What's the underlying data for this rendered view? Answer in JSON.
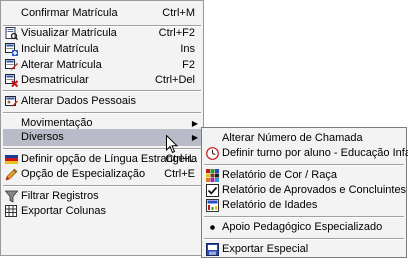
{
  "main_menu": {
    "items": [
      {
        "label": "Confirmar Matrícula",
        "shortcut": "Ctrl+M",
        "icon": "none"
      },
      {
        "label": "Visualizar Matrícula",
        "shortcut": "Ctrl+F2",
        "icon": "view-document-icon"
      },
      {
        "label": "Incluir Matrícula",
        "shortcut": "Ins",
        "icon": "add-document-icon"
      },
      {
        "label": "Alterar Matrícula",
        "shortcut": "F2",
        "icon": "edit-document-icon"
      },
      {
        "label": "Desmatricular",
        "shortcut": "Ctrl+Del",
        "icon": "remove-document-icon"
      },
      {
        "label": "Alterar Dados Pessoais",
        "shortcut": "",
        "icon": "person-edit-icon"
      },
      {
        "label": "Movimentação",
        "shortcut": "",
        "icon": "none"
      },
      {
        "label": "Diversos",
        "shortcut": "",
        "icon": "none"
      },
      {
        "label": "Definir opção de Língua Estrangeira",
        "shortcut": "Ctrl+L",
        "icon": "flag-icon"
      },
      {
        "label": "Opção de Especialização",
        "shortcut": "Ctrl+E",
        "icon": "pencil-icon"
      },
      {
        "label": "Filtrar Registros",
        "shortcut": "",
        "icon": "filter-icon"
      },
      {
        "label": "Exportar Colunas",
        "shortcut": "",
        "icon": "export-columns-icon"
      }
    ]
  },
  "sub_menu": {
    "items": [
      {
        "label": "Alterar Número de Chamada",
        "icon": "none"
      },
      {
        "label": "Definir turno por aluno - Educação Infantil",
        "icon": "clock-icon"
      },
      {
        "label": "Relatório de Cor / Raça",
        "icon": "color-grid-icon"
      },
      {
        "label": "Relatório de Aprovados e Concluintes",
        "icon": "checkbox-icon"
      },
      {
        "label": "Relatório de Idades",
        "icon": "report-icon"
      },
      {
        "label": "Apoio Pedagógico Especializado",
        "icon": "bullet-icon"
      },
      {
        "label": "Exportar Especial",
        "icon": "export-icon"
      }
    ]
  }
}
